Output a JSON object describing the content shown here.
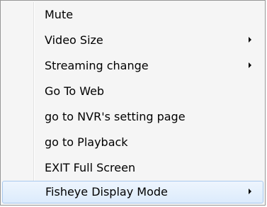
{
  "context_menu": {
    "items": [
      {
        "label": "Mute",
        "submenu": false
      },
      {
        "label": "Video Size",
        "submenu": true
      },
      {
        "label": "Streaming change",
        "submenu": true
      },
      {
        "label": "Go To Web",
        "submenu": false
      },
      {
        "label": "go to NVR's setting page",
        "submenu": false
      },
      {
        "label": "go to Playback",
        "submenu": false
      },
      {
        "label": "EXIT Full Screen",
        "submenu": false
      },
      {
        "label": "Fisheye Display Mode",
        "submenu": true,
        "highlighted": true
      }
    ],
    "highlight_color": "#dcebfc",
    "highlight_border": "#a9c9ef"
  }
}
